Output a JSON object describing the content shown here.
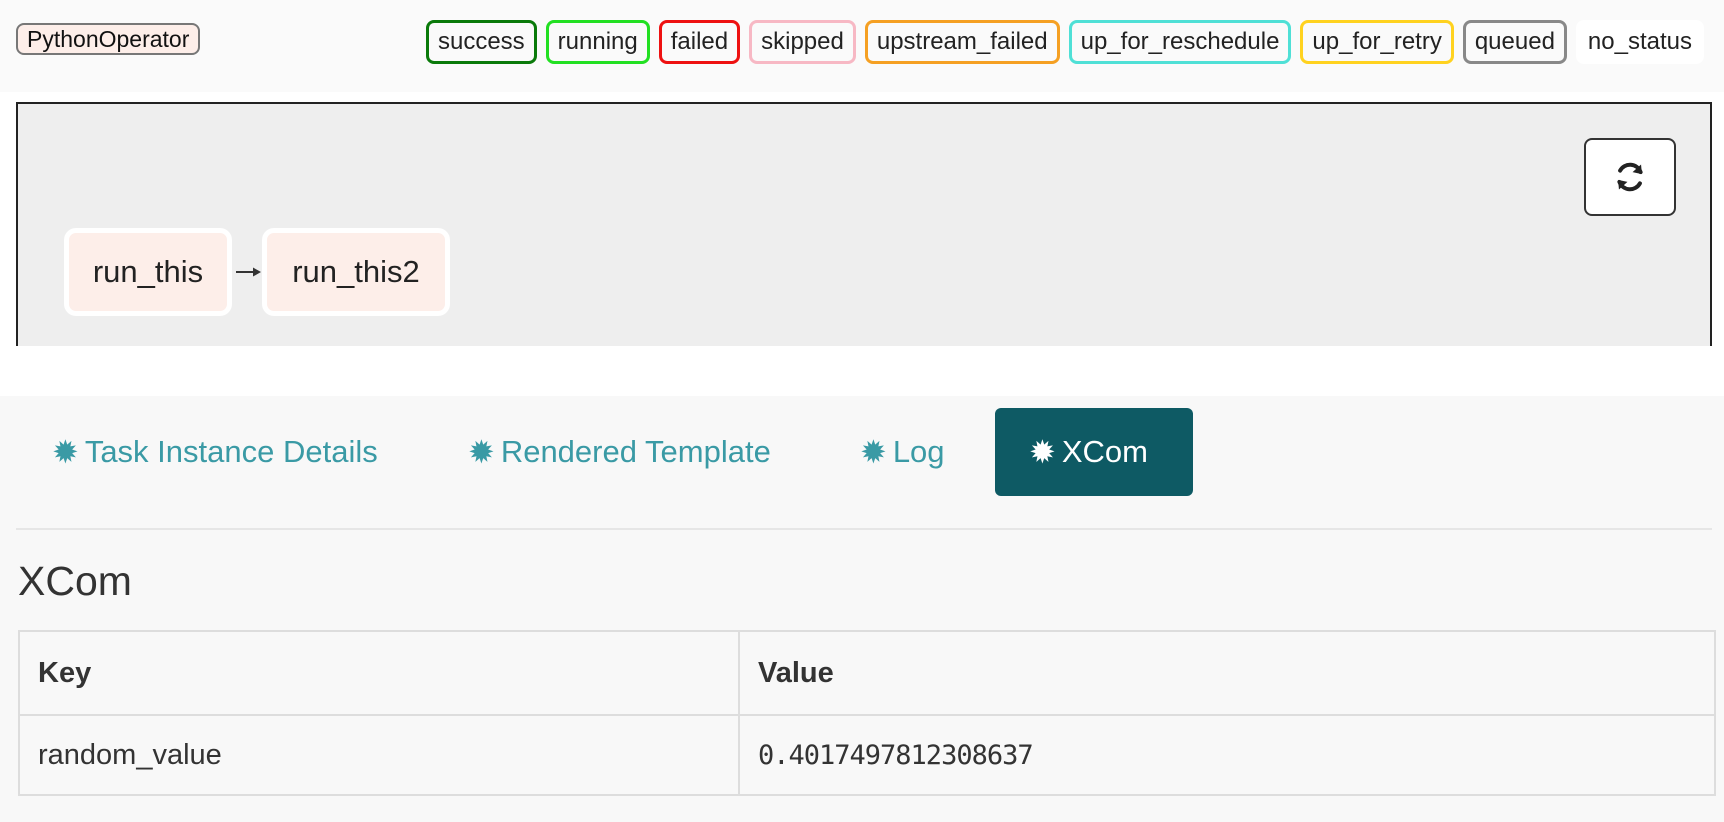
{
  "legend": {
    "operator": {
      "label": "PythonOperator",
      "color": "#fdeee9"
    },
    "states": [
      {
        "label": "success",
        "color": "#008000"
      },
      {
        "label": "running",
        "color": "#00ff00"
      },
      {
        "label": "failed",
        "color": "#ff0000"
      },
      {
        "label": "skipped",
        "color": "#ffc0cb"
      },
      {
        "label": "upstream_failed",
        "color": "#ffa500"
      },
      {
        "label": "up_for_reschedule",
        "color": "#40e0d0"
      },
      {
        "label": "up_for_retry",
        "color": "#ffd700"
      },
      {
        "label": "queued",
        "color": "#808080"
      },
      {
        "label": "no_status",
        "color": "#ffffff"
      }
    ]
  },
  "graph": {
    "refresh_icon": "refresh-icon",
    "tasks": [
      {
        "label": "run_this"
      },
      {
        "label": "run_this2"
      }
    ],
    "edge_icon": "arrow-right-icon"
  },
  "tabs": [
    {
      "label": "Task Instance Details",
      "icon": "asterisk-icon",
      "active": false
    },
    {
      "label": "Rendered Template",
      "icon": "asterisk-icon",
      "active": false
    },
    {
      "label": "Log",
      "icon": "asterisk-icon",
      "active": false
    },
    {
      "label": "XCom",
      "icon": "asterisk-icon",
      "active": true
    }
  ],
  "xcom": {
    "heading": "XCom",
    "columns": {
      "key": "Key",
      "value": "Value"
    },
    "rows": [
      {
        "key": "random_value",
        "value": "0.4017497812308637"
      }
    ]
  },
  "colors": {
    "active_tab_bg": "#0e5a64",
    "tab_text": "#3a9aa5"
  }
}
